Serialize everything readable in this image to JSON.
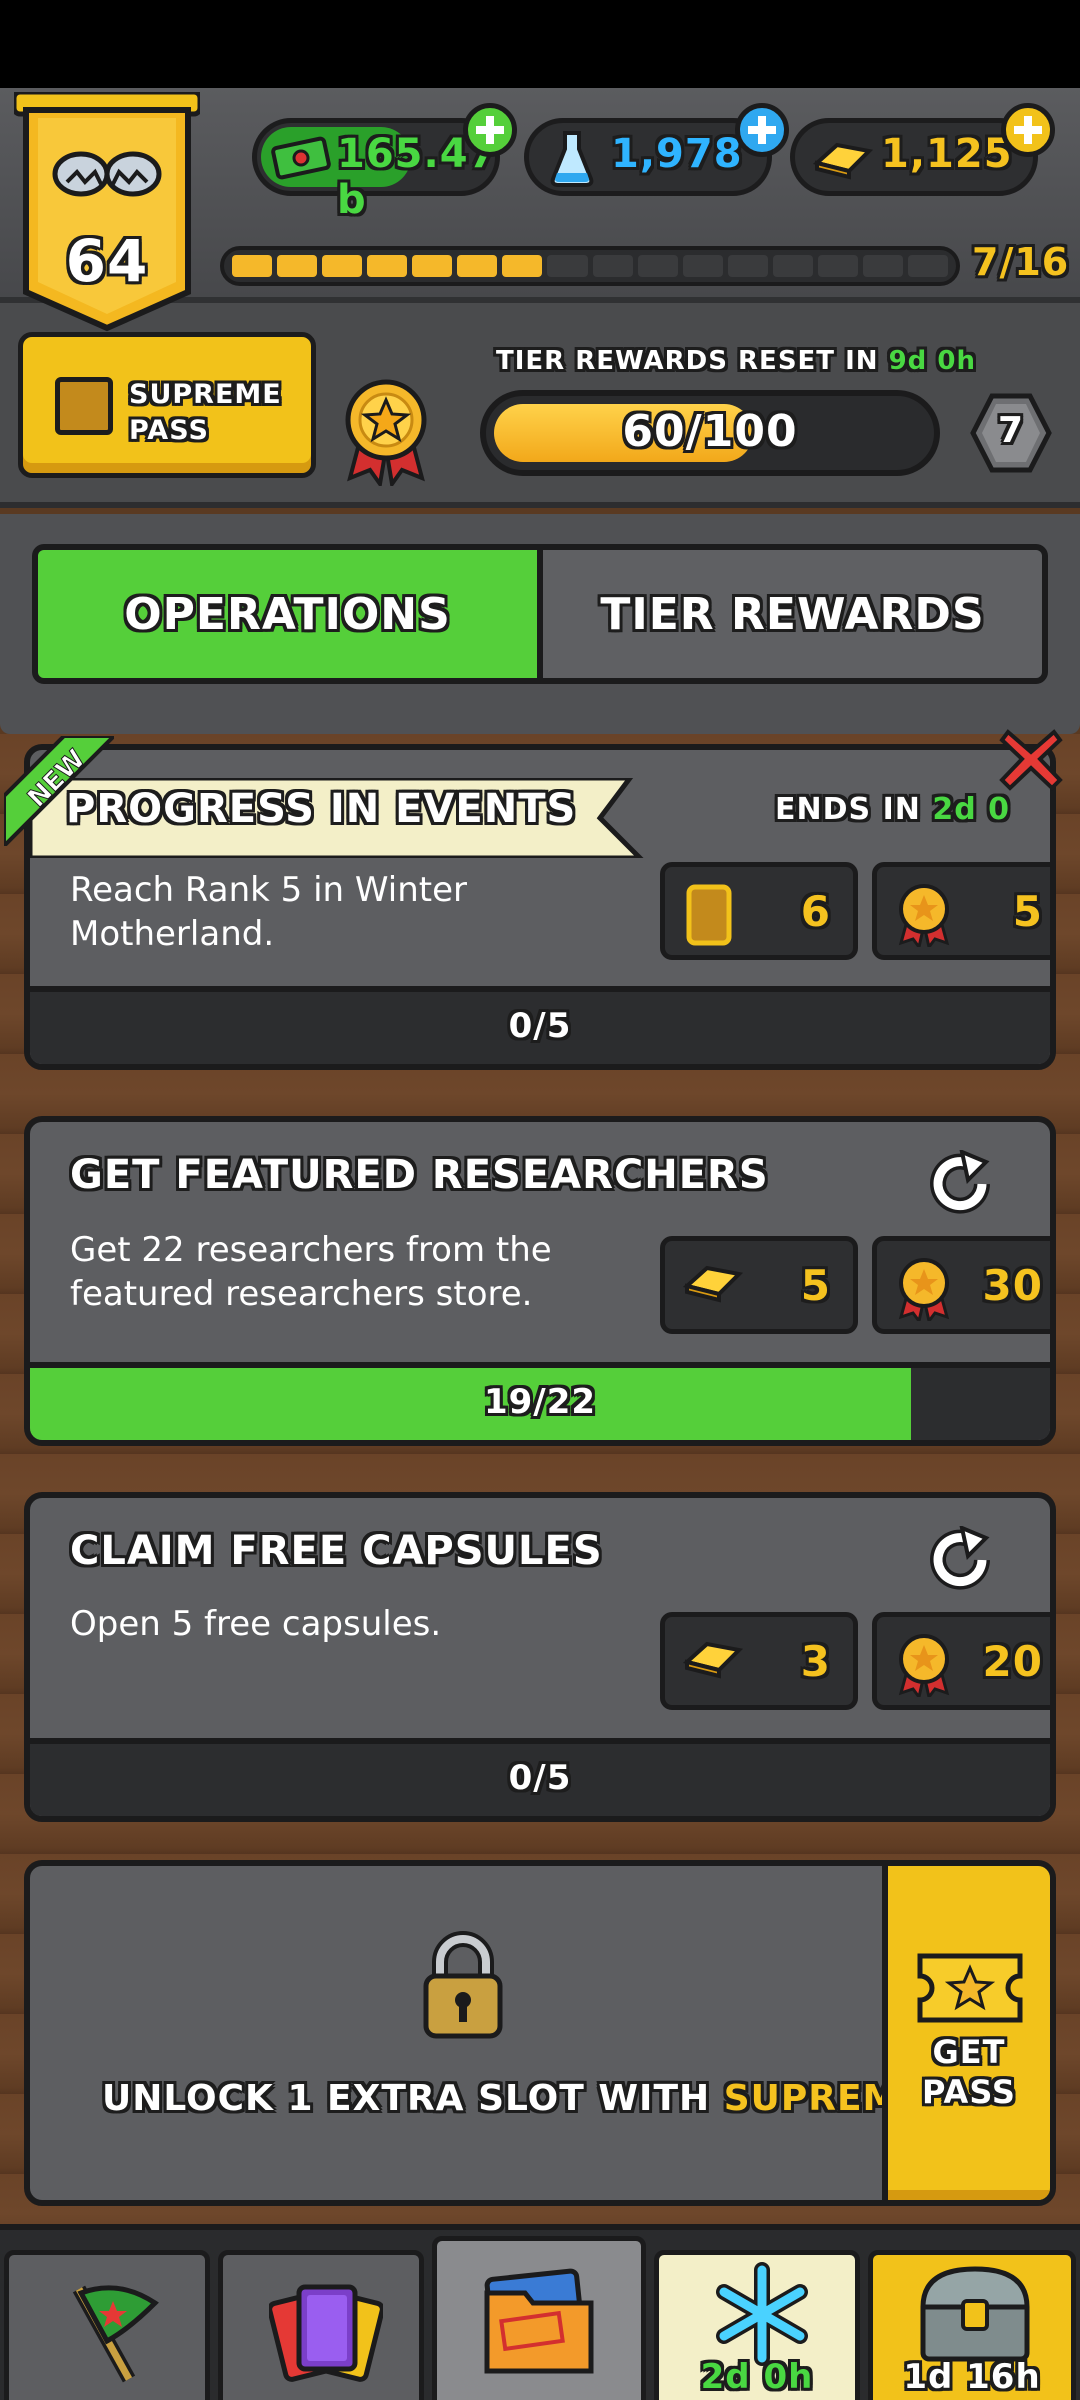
{
  "header": {
    "rank_level": "64",
    "currencies": [
      {
        "name": "cash",
        "value": "165.47 b",
        "icon": "cash-icon",
        "plus_color": "#55cf3a"
      },
      {
        "name": "science",
        "value": "1,978",
        "icon": "flask-icon",
        "plus_color": "#2fa8f0"
      },
      {
        "name": "gold",
        "value": "1,125",
        "icon": "gold-bar-icon",
        "plus_color": "#f2c21a"
      }
    ],
    "xp_segments_filled": 7,
    "xp_segments_total": 16,
    "xp_text": "7/16",
    "supreme_pass_label": "SUPREME PASS",
    "tier_reset_label": "TIER REWARDS RESET IN",
    "tier_reset_time": "9d 0h",
    "tier_progress_value": 60,
    "tier_progress_max": 100,
    "tier_progress_text": "60/100",
    "tier_level": "7"
  },
  "tabs": {
    "operations": "OPERATIONS",
    "tier_rewards": "TIER REWARDS"
  },
  "cards": [
    {
      "title": "PROGRESS IN EVENTS",
      "badge": "NEW",
      "ends_label": "ENDS IN",
      "ends_time": "2d 0",
      "desc": "Reach Rank 5 in Winter Motherland.",
      "reward1": "6",
      "reward2": "5",
      "progress_value": 0,
      "progress_max": 5,
      "progress_text": "0/5"
    },
    {
      "title": "GET FEATURED RESEARCHERS",
      "desc": "Get 22 researchers from the featured researchers store.",
      "reward1": "5",
      "reward2": "30",
      "progress_value": 19,
      "progress_max": 22,
      "progress_text": "19/22"
    },
    {
      "title": "CLAIM FREE CAPSULES",
      "desc": "Open 5 free capsules.",
      "reward1": "3",
      "reward2": "20",
      "progress_value": 0,
      "progress_max": 5,
      "progress_text": "0/5"
    }
  ],
  "unlock": {
    "msg_prefix": "UNLOCK 1 EXTRA SLOT WITH",
    "msg_highlight": "SUPREME PASS",
    "get_pass": "GET PASS"
  },
  "bottom_nav": {
    "event_timer": "2d 0h",
    "chest_timer": "1d 16h"
  },
  "colors": {
    "green": "#55cf3a",
    "gold": "#f2c21a",
    "panel": "#5d5e61"
  }
}
